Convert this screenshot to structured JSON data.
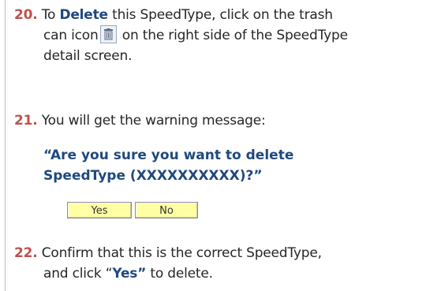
{
  "steps": {
    "s20": {
      "number": "20.",
      "line1_pre": "To ",
      "line1_em": "Delete",
      "line1_post": " this SpeedType, click on the trash",
      "line2_pre": "can icon",
      "line2_post": " on the right side of the SpeedType",
      "line3": "detail screen."
    },
    "s21": {
      "number": "21.",
      "text": "You will get the warning message:",
      "warning_line1": "“Are you sure you want to delete",
      "warning_line2": "SpeedType (XXXXXXXXXX)?”"
    },
    "s22": {
      "number": "22.",
      "line1": "Confirm that this is the correct SpeedType,",
      "line2_pre": "and click “",
      "line2_em": "Yes”",
      "line2_post": " to delete."
    }
  },
  "dialog": {
    "yes_label": "Yes",
    "no_label": "No"
  },
  "icons": {
    "inline_icon": "trash-icon"
  },
  "colors": {
    "step_number": "#c0504d",
    "emphasis": "#1f497d",
    "button_bg": "#ffffa6"
  }
}
